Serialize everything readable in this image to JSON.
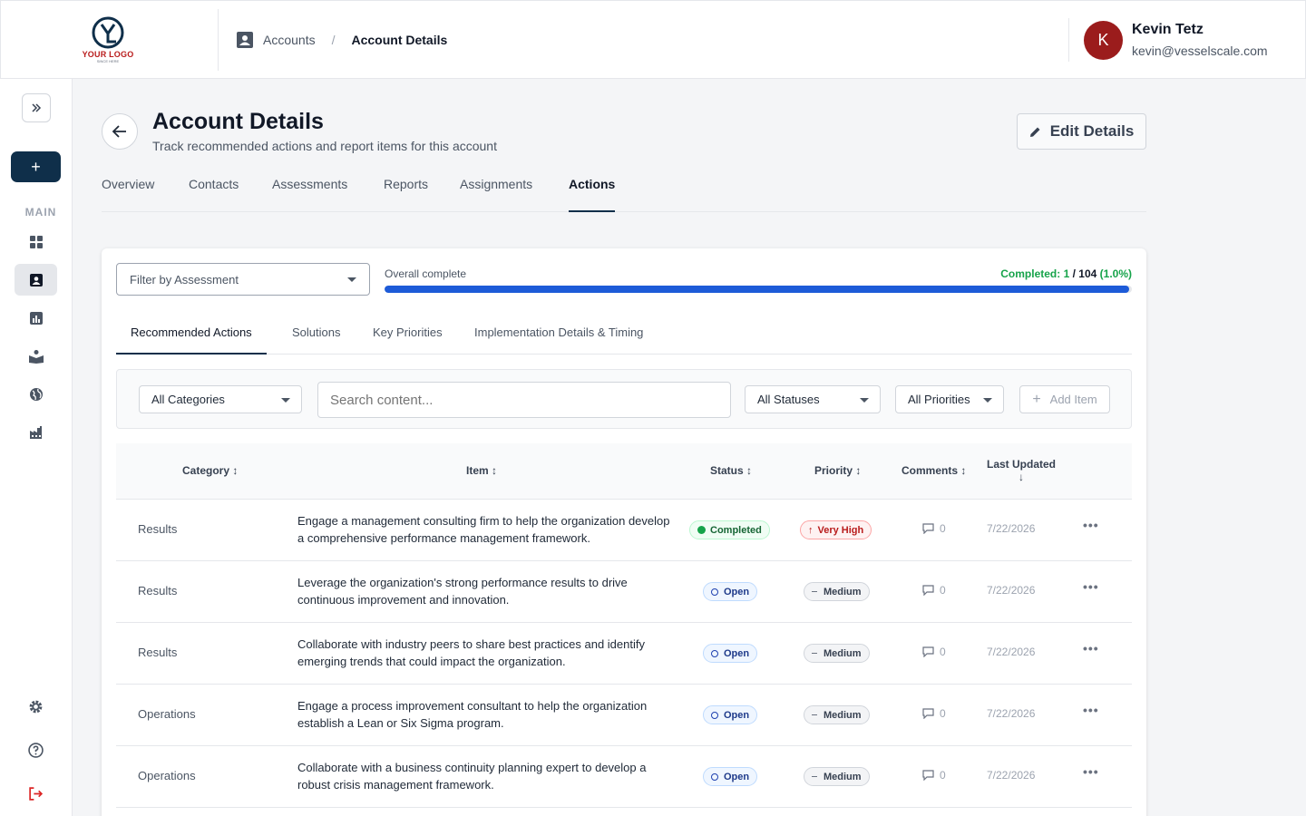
{
  "header": {
    "logo_text": "YOUR LOGO",
    "logo_sub": "SINCE HERE",
    "breadcrumb": {
      "parent": "Accounts",
      "separator": "/",
      "current": "Account Details"
    },
    "user": {
      "initial": "K",
      "name": "Kevin Tetz",
      "email": "kevin@vesselscale.com"
    }
  },
  "sidebar": {
    "expand_icon": "chevrons-right-icon",
    "add_label": "+",
    "section_label": "MAIN",
    "items": [
      "dashboard-icon",
      "accounts-icon",
      "reports-icon",
      "learning-icon",
      "globe-icon",
      "factory-icon"
    ],
    "bottom": [
      "settings-icon",
      "help-icon",
      "logout-icon"
    ]
  },
  "page": {
    "title": "Account Details",
    "subtitle": "Track recommended actions and report items for this account",
    "edit_label": "Edit Details",
    "tabs": [
      "Overview",
      "Contacts",
      "Assessments",
      "Reports",
      "Assignments",
      "Actions"
    ],
    "active_tab": "Actions"
  },
  "card": {
    "filter_placeholder": "Filter by Assessment",
    "progress": {
      "label": "Overall complete",
      "completed_label": "Completed: 1",
      "total_label": "/ 104",
      "percent_label": "(1.0%)",
      "fraction": 0.996
    },
    "sub_tabs": [
      "Recommended Actions",
      "Solutions",
      "Key Priorities",
      "Implementation Details & Timing"
    ],
    "toolbar": {
      "categories": "All Categories",
      "search_placeholder": "Search content...",
      "statuses": "All Statuses",
      "priorities": "All Priorities",
      "add_label": "Add Item"
    },
    "table": {
      "headers": {
        "category": "Category ↕",
        "item": "Item ↕",
        "status": "Status ↕",
        "priority": "Priority ↕",
        "comments": "Comments ↕",
        "last_updated": "Last Updated",
        "sort_arrow": "↓"
      },
      "rows": [
        {
          "category": "Results",
          "item": "Engage a management consulting firm to help the organization develop a comprehensive performance management framework.",
          "status": "Completed",
          "priority": "Very High",
          "comments": "0",
          "date": "7/22/2026",
          "more": "•••"
        },
        {
          "category": "Results",
          "item": "Leverage the organization's strong performance results to drive continuous improvement and innovation.",
          "status": "Open",
          "priority": "Medium",
          "comments": "0",
          "date": "7/22/2026",
          "more": "•••"
        },
        {
          "category": "Results",
          "item": "Collaborate with industry peers to share best practices and identify emerging trends that could impact the organization.",
          "status": "Open",
          "priority": "Medium",
          "comments": "0",
          "date": "7/22/2026",
          "more": "•••"
        },
        {
          "category": "Operations",
          "item": "Engage a process improvement consultant to help the organization establish a Lean or Six Sigma program.",
          "status": "Open",
          "priority": "Medium",
          "comments": "0",
          "date": "7/22/2026",
          "more": "•••"
        },
        {
          "category": "Operations",
          "item": "Collaborate with a business continuity planning expert to develop a robust crisis management framework.",
          "status": "Open",
          "priority": "Medium",
          "comments": "0",
          "date": "7/22/2026",
          "more": "•••"
        }
      ]
    }
  },
  "colors": {
    "brand_dark": "#0f2f4a",
    "progress": "#1d5bd8",
    "completed_green": "#16a34a",
    "avatar": "#9b1c1c"
  }
}
